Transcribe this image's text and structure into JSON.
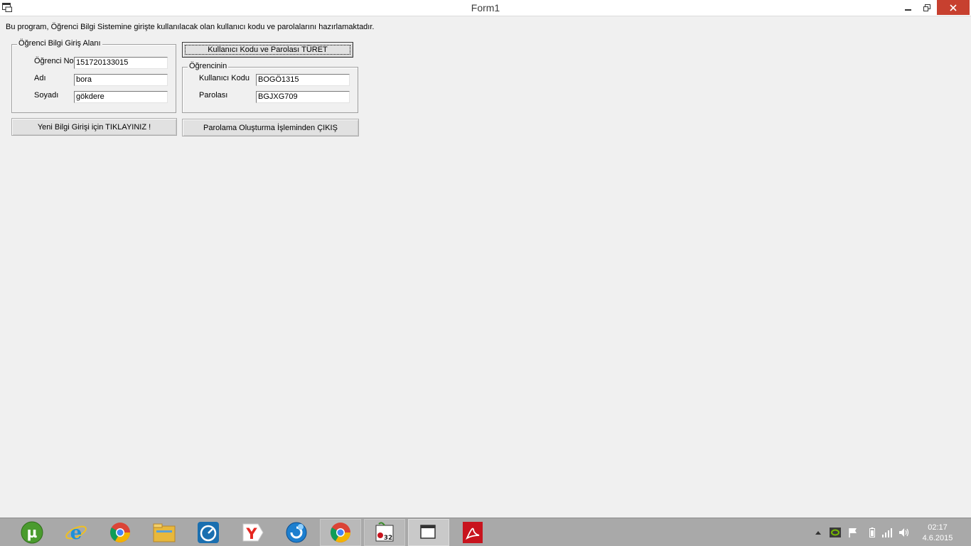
{
  "window": {
    "title": "Form1"
  },
  "form": {
    "description": "Bu program, Öğrenci Bilgi Sistemine girişte kullanılacak olan kullanıcı kodu ve parolalarını hazırlamaktadır.",
    "student_group": {
      "title": "Öğrenci Bilgi Giriş Alanı",
      "student_no_label": "Öğrenci No",
      "student_no_value": "151720133015",
      "name_label": "Adı",
      "name_value": "bora",
      "surname_label": "Soyadı",
      "surname_value": "gökdere"
    },
    "generate_button": "Kullanıcı Kodu ve Parolası TÜRET",
    "result_group": {
      "title": "Öğrencinin",
      "user_code_label": "Kullanıcı Kodu",
      "user_code_value": "BOGÖ1315",
      "password_label": "Parolası",
      "password_value": "BGJXG709"
    },
    "new_entry_button": "Yeni Bilgi Girişi için TIKLAYINIZ !",
    "exit_button": "Parolama Oluşturma İşleminden ÇIKIŞ"
  },
  "taskbar": {
    "apps": [
      {
        "icon": "utorrent-icon",
        "color": "#4a9b2e"
      },
      {
        "icon": "internet-explorer-icon",
        "color": "#1e90d8"
      },
      {
        "icon": "chrome-icon",
        "color": "#db4437"
      },
      {
        "icon": "file-explorer-icon",
        "color": "#e8b83c"
      },
      {
        "icon": "speedometer-icon",
        "color": "#1a6fb0"
      },
      {
        "icon": "yandex-icon",
        "color": "#e52620"
      },
      {
        "icon": "browser-globe-icon",
        "color": "#1d7fcf"
      },
      {
        "icon": "chrome-icon",
        "color": "#db4437"
      },
      {
        "icon": "program-32-icon",
        "color": "#3a3a3a"
      },
      {
        "icon": "window-app-icon",
        "color": "#ffffff"
      },
      {
        "icon": "adobe-reader-icon",
        "color": "#c8141e"
      }
    ],
    "clock_time": "02:17",
    "clock_date": "4.6.2015"
  }
}
